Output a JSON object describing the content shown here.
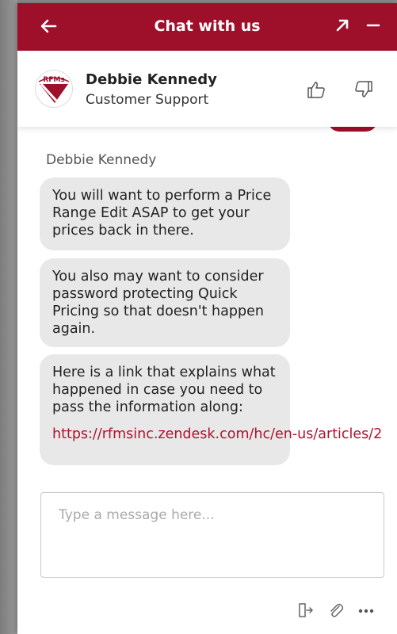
{
  "header": {
    "title": "Chat with us",
    "back_icon": "arrow-left-icon",
    "popout_icon": "arrow-up-right-icon",
    "minimize_icon": "minus-icon",
    "bg_color": "#9e0f2a"
  },
  "agent": {
    "name": "Debbie Kennedy",
    "role": "Customer Support",
    "avatar_text": "RFMs"
  },
  "messages": {
    "sender": "Debbie Kennedy",
    "items": [
      {
        "text": "You will want to perform a Price Range Edit ASAP to get your prices back in there."
      },
      {
        "text": "You also may want to consider password protecting Quick Pricing so that doesn't happen again."
      },
      {
        "text": "Here is a link that explains what happened in case you need to pass the information along:",
        "link": "https://rfmsinc.zendesk.com/hc/en-us/articles/2"
      }
    ]
  },
  "composer": {
    "placeholder": "Type a message here..."
  },
  "footer": {
    "end_icon": "exit-icon",
    "attach_icon": "paperclip-icon",
    "more_icon": "ellipsis-icon"
  }
}
